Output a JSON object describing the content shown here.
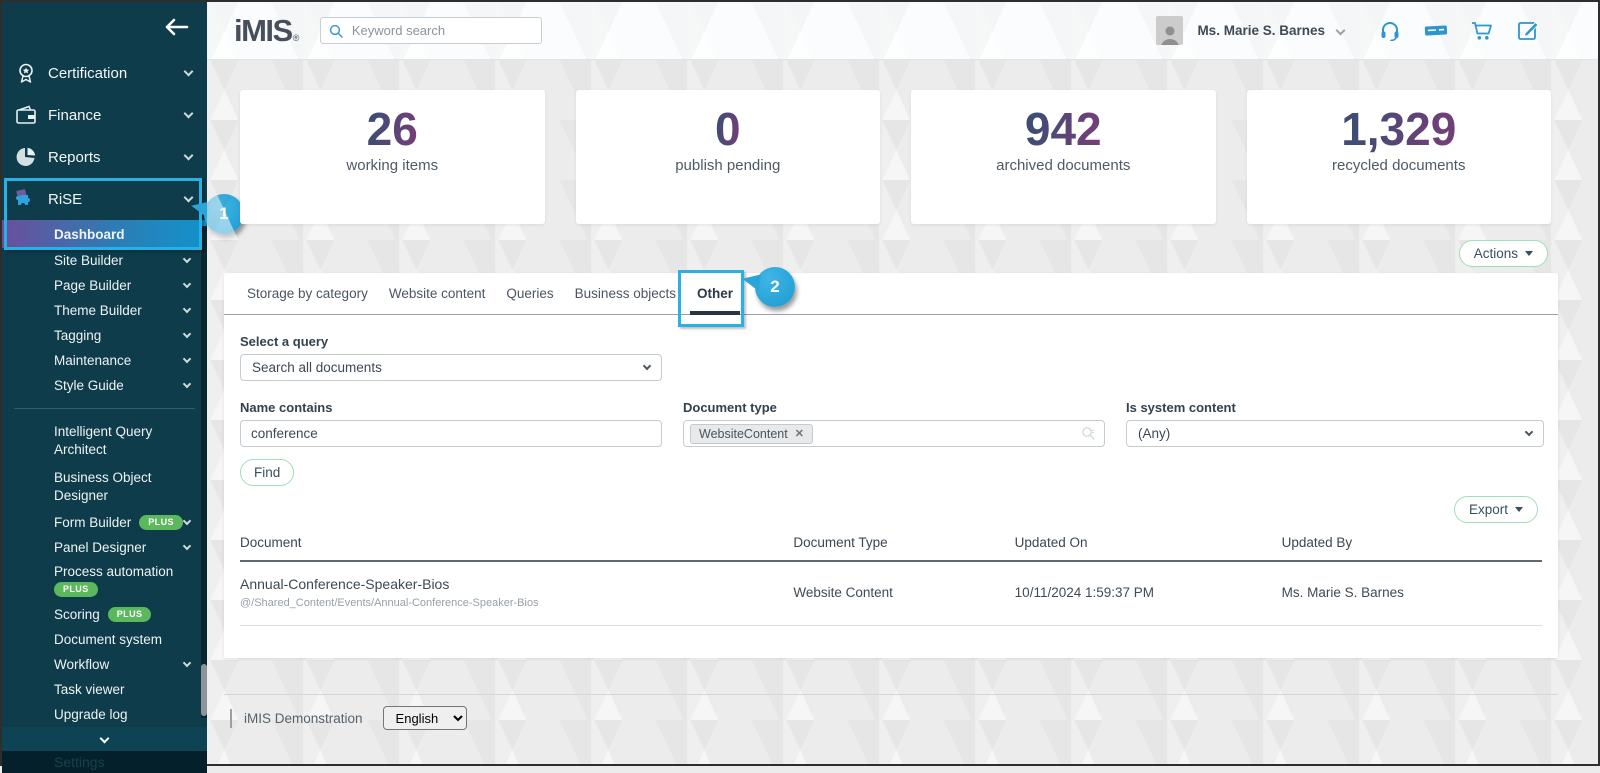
{
  "header": {
    "logo_text": "iMIS",
    "logo_mark": "®",
    "search_placeholder": "Keyword search",
    "user_name": "Ms. Marie S. Barnes"
  },
  "sidebar": {
    "items": {
      "certification": "Certification",
      "finance": "Finance",
      "reports": "Reports",
      "rise": "RiSE",
      "dashboard": "Dashboard",
      "site_builder": "Site Builder",
      "page_builder": "Page Builder",
      "theme_builder": "Theme Builder",
      "tagging": "Tagging",
      "maintenance": "Maintenance",
      "style_guide": "Style Guide",
      "intelligent_query_architect": "Intelligent Query Architect",
      "business_object_designer": "Business Object Designer",
      "form_builder": "Form Builder",
      "panel_designer": "Panel Designer",
      "process_automation": "Process automation",
      "scoring": "Scoring",
      "document_system": "Document system",
      "workflow": "Workflow",
      "task_viewer": "Task viewer",
      "upgrade_log": "Upgrade log",
      "settings": "Settings"
    },
    "plus_badge": "PLUS"
  },
  "annotations": {
    "step1": "1",
    "step2": "2"
  },
  "stats": [
    {
      "value": "26",
      "label": "working items"
    },
    {
      "value": "0",
      "label": "publish pending"
    },
    {
      "value": "942",
      "label": "archived documents"
    },
    {
      "value": "1,329",
      "label": "recycled documents"
    }
  ],
  "toolbar": {
    "actions_label": "Actions",
    "export_label": "Export"
  },
  "tabs": {
    "items": [
      "Storage by category",
      "Website content",
      "Queries",
      "Business objects",
      "Other"
    ],
    "active": "Other"
  },
  "filters": {
    "query_label": "Select a query",
    "query_value": "Search all documents",
    "name_label": "Name contains",
    "name_value": "conference",
    "type_label": "Document type",
    "type_chip": "WebsiteContent",
    "system_label": "Is system content",
    "system_value": "(Any)",
    "find_label": "Find"
  },
  "table": {
    "columns": [
      "Document",
      "Document Type",
      "Updated On",
      "Updated By"
    ],
    "rows": [
      {
        "name": "Annual-Conference-Speaker-Bios",
        "path": "@/Shared_Content/Events/Annual-Conference-Speaker-Bios",
        "type": "Website Content",
        "updated_on": "10/11/2024 1:59:37 PM",
        "updated_by": "Ms. Marie S. Barnes"
      }
    ]
  },
  "footer": {
    "site_name": "iMIS Demonstration",
    "language": "English"
  },
  "colors": {
    "accent_cyan": "#29b0e4",
    "sidebar_bg": "#0e3c4a",
    "selected_gradient_start": "#6b4e9b",
    "selected_gradient_end": "#1193cc",
    "badge_green": "#5cb85c",
    "button_border_green": "#9edfb6",
    "stat_number_gradient_start": "#3f4d74",
    "stat_number_gradient_end": "#713f78",
    "header_icon_blue": "#2e96cc"
  }
}
